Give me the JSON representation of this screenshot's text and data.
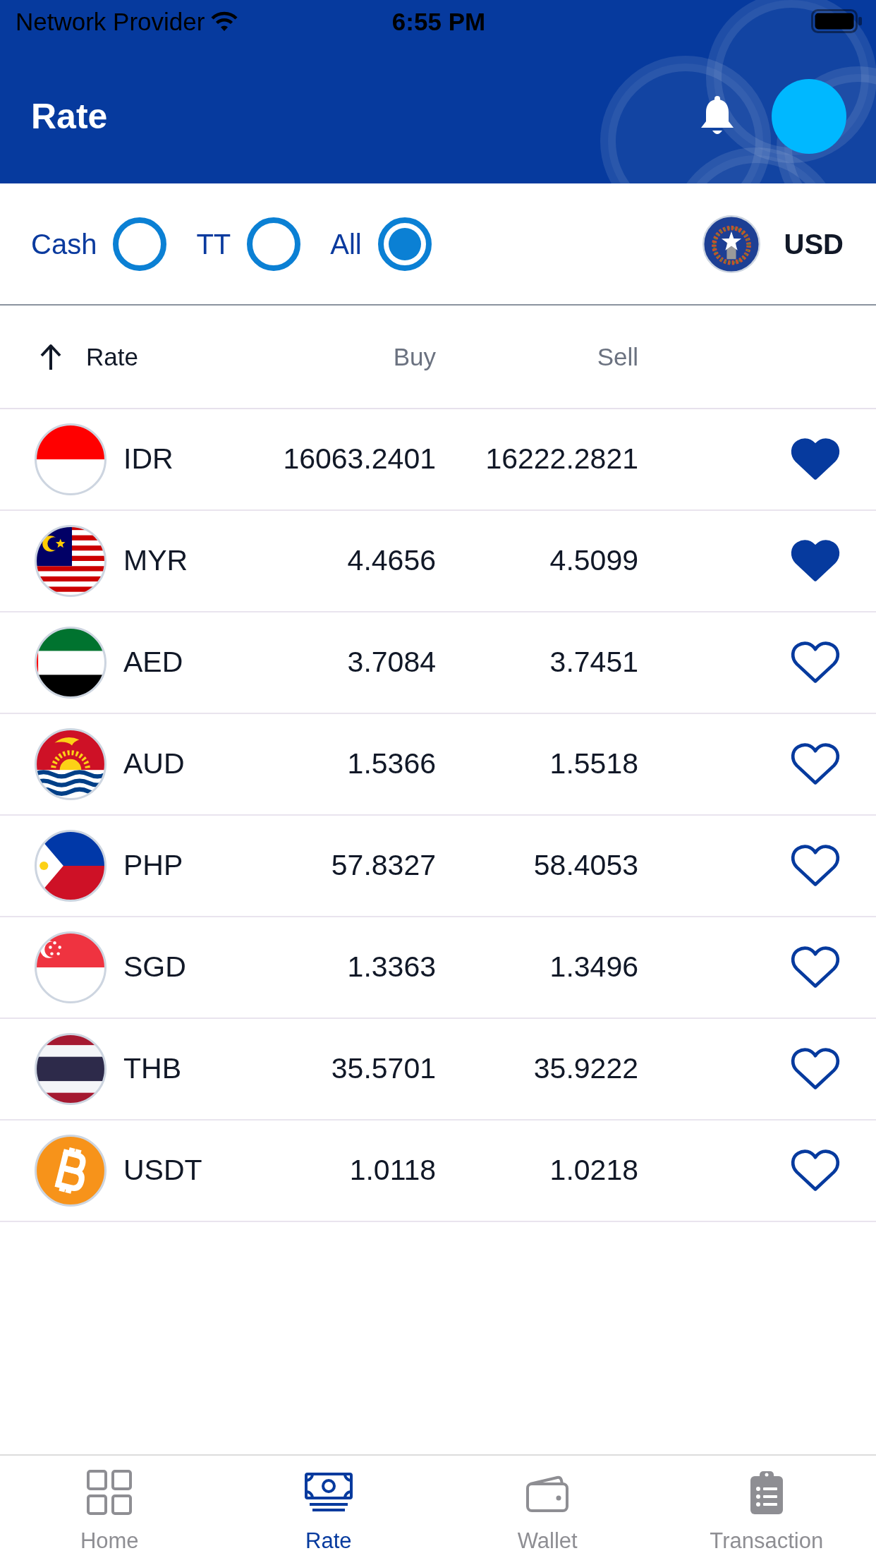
{
  "status_bar": {
    "carrier": "Network Provider",
    "time": "6:55 PM"
  },
  "header": {
    "title": "Rate"
  },
  "filters": [
    {
      "label": "Cash",
      "selected": false
    },
    {
      "label": "TT",
      "selected": false
    },
    {
      "label": "All",
      "selected": true
    }
  ],
  "base_currency": {
    "code": "USD"
  },
  "table": {
    "columns": [
      "Rate",
      "Buy",
      "Sell"
    ],
    "rows": [
      {
        "code": "IDR",
        "buy": "16063.2401",
        "sell": "16222.2821",
        "favorite": true
      },
      {
        "code": "MYR",
        "buy": "4.4656",
        "sell": "4.5099",
        "favorite": true
      },
      {
        "code": "AED",
        "buy": "3.7084",
        "sell": "3.7451",
        "favorite": false
      },
      {
        "code": "AUD",
        "buy": "1.5366",
        "sell": "1.5518",
        "favorite": false
      },
      {
        "code": "PHP",
        "buy": "57.8327",
        "sell": "58.4053",
        "favorite": false
      },
      {
        "code": "SGD",
        "buy": "1.3363",
        "sell": "1.3496",
        "favorite": false
      },
      {
        "code": "THB",
        "buy": "35.5701",
        "sell": "35.9222",
        "favorite": false
      },
      {
        "code": "USDT",
        "buy": "1.0118",
        "sell": "1.0218",
        "favorite": false
      }
    ]
  },
  "tab_bar": [
    {
      "label": "Home",
      "selected": false
    },
    {
      "label": "Rate",
      "selected": true
    },
    {
      "label": "Wallet",
      "selected": false
    },
    {
      "label": "Transaction",
      "selected": false
    }
  ]
}
